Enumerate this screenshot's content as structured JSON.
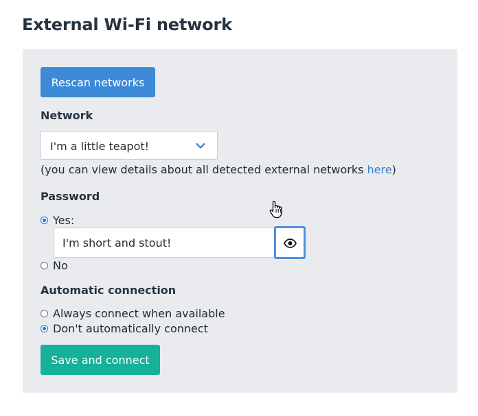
{
  "page": {
    "title": "External Wi-Fi network"
  },
  "actions": {
    "rescan_label": "Rescan networks",
    "save_label": "Save and connect"
  },
  "network": {
    "label": "Network",
    "selected": "I'm a little teapot!",
    "hint_prefix": "(you can view details about all detected external networks ",
    "hint_link": "here",
    "hint_suffix": ")"
  },
  "password": {
    "label": "Password",
    "yes_label": "Yes:",
    "yes_checked": true,
    "value": "I'm short and stout!",
    "no_label": "No",
    "no_checked": false,
    "reveal_icon": "eye-icon"
  },
  "auto_connect": {
    "label": "Automatic connection",
    "always_label": "Always connect when available",
    "always_checked": false,
    "never_label": "Don't automatically connect",
    "never_checked": true
  },
  "colors": {
    "rescan_button": "#3d8ad8",
    "save_button": "#15b198",
    "panel_background": "#e9ebef",
    "link": "#3d7fcc"
  }
}
